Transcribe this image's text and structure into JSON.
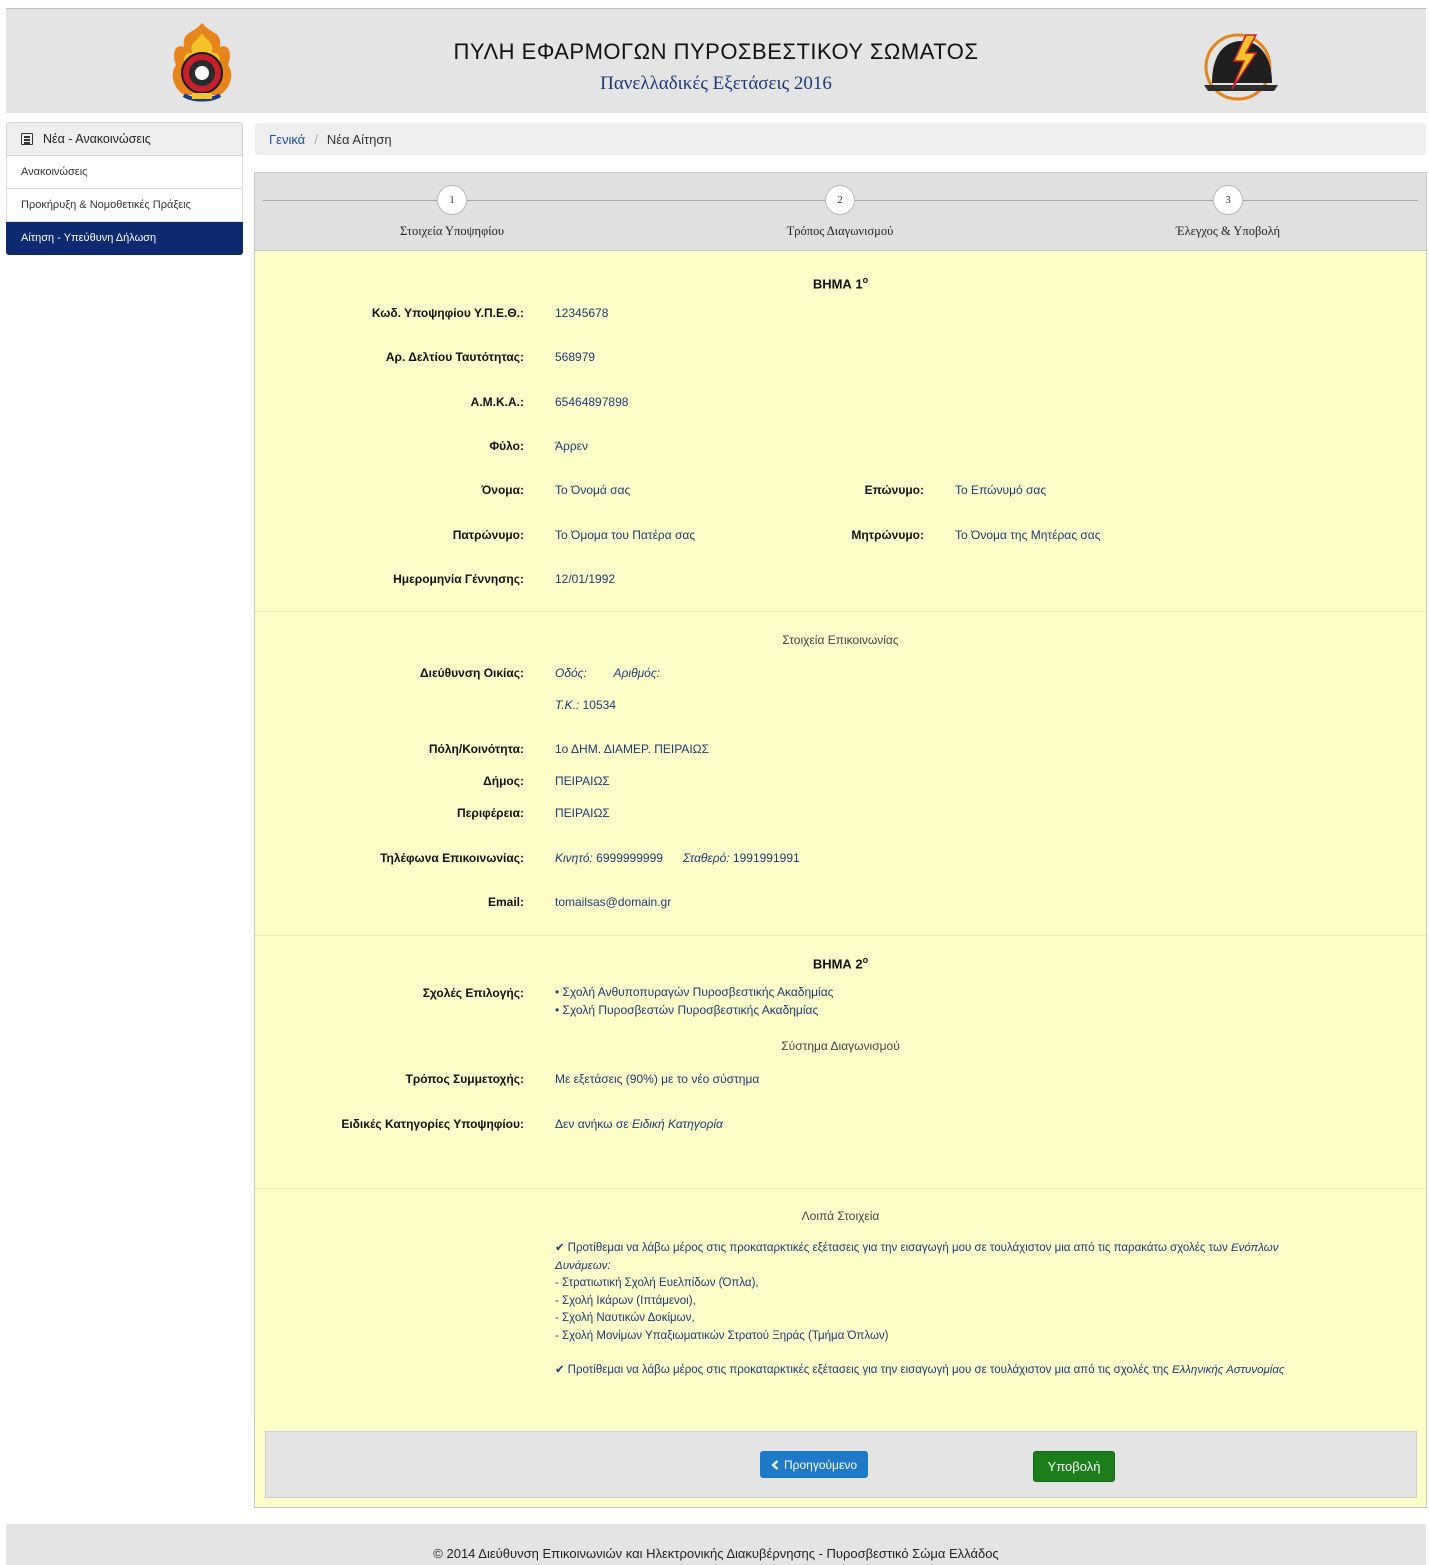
{
  "header": {
    "title": "ΠΥΛΗ ΕΦΑΡΜΟΓΩΝ ΠΥΡΟΣΒΕΣΤΙΚΟΥ ΣΩΜΑΤΟΣ",
    "subtitle": "Πανελλαδικές Εξετάσεις 2016",
    "logo_left": "fire-service-emblem",
    "logo_right": "firefighter-helmet-logo"
  },
  "sidebar": {
    "heading": "Νέα - Ανακοινώσεις",
    "heading_icon": "newspaper-icon",
    "items": [
      {
        "label": "Ανακοινώσεις"
      },
      {
        "label": "Προκήρυξη & Νομοθετικές Πράξεις"
      },
      {
        "label": "Αίτηση - Υπεύθυνη Δήλωση"
      }
    ]
  },
  "breadcrumb": {
    "home": "Γενικά",
    "separator": "/",
    "current": "Νέα Αίτηση"
  },
  "steps": [
    {
      "number": "1",
      "label": "Στοιχεία Υποψηφίου"
    },
    {
      "number": "2",
      "label": "Τρόπος Διαγωνισμού"
    },
    {
      "number": "3",
      "label": "Έλεγχος & Υποβολή"
    }
  ],
  "active_step_number": "3",
  "step1": {
    "title_main": "ΒΗΜΑ 1",
    "title_sup": "ο",
    "fields": {
      "code_label": "Κωδ. Υποψηφίου Υ.Π.Ε.Θ.:",
      "code_value": "12345678",
      "id_label": "Αρ. Δελτίου Ταυτότητας:",
      "id_value": "568979",
      "amka_label": "Α.Μ.Κ.Α.:",
      "amka_value": "65464897898",
      "gender_label": "Φύλο:",
      "gender_value": "Άρρεν",
      "name_label": "Όνομα:",
      "name_value": "Το Όνομά σας",
      "surname_label": "Επώνυμο:",
      "surname_value": "Το Επώνυμό σας",
      "father_label": "Πατρώνυμο:",
      "father_value": "Το Όμομα του Πατέρα σας",
      "mother_label": "Μητρώνυμο:",
      "mother_value": "Το Όνομα της Μητέρας σας",
      "dob_label": "Ημερομηνία Γέννησης:",
      "dob_value": "12/01/1992"
    }
  },
  "contact": {
    "title": "Στοιχεία Επικοινωνίας",
    "address_label": "Διεύθυνση Οικίας:",
    "street_label": "Οδός:",
    "number_label": "Αριθμός:",
    "postcode_label": "Τ.Κ.:",
    "postcode_value": "10534",
    "city_label": "Πόλη/Κοινότητα:",
    "city_value": "1ο ΔΗΜ. ΔΙΑΜΕΡ. ΠΕΙΡΑΙΩΣ",
    "municipality_label": "Δήμος:",
    "municipality_value": "ΠΕΙΡΑΙΩΣ",
    "region_label": "Περιφέρεια:",
    "region_value": "ΠΕΙΡΑΙΩΣ",
    "phones_label": "Τηλέφωνα Επικοινωνίας:",
    "mobile_label": "Κινητό:",
    "mobile_value": "6999999999",
    "landline_label": "Σταθερό:",
    "landline_value": "1991991991",
    "email_label": "Email:",
    "email_value": "tomailsas@domain.gr"
  },
  "step2": {
    "title_main": "ΒΗΜΑ 2",
    "title_sup": "ο",
    "schools_label": "Σχολές Επιλογής:",
    "schools": [
      "• Σχολή Ανθυποπυραγών Πυροσβεστικής Ακαδημίας",
      "• Σχολή Πυροσβεστών Πυροσβεστικής Ακαδημίας"
    ],
    "system_title": "Σύστημα Διαγωνισμού",
    "participation_label": "Τρόπος Συμμετοχής:",
    "participation_value": "Με εξετάσεις (90%) με το νέο σύστημα",
    "special_label": "Ειδικές Κατηγορίες Υποψηφίου:",
    "special_value_prefix": "Δεν ανήκω σε",
    "special_value_em": "Ειδική Κατηγορία"
  },
  "other": {
    "title": "Λοιπά Στοιχεία",
    "note1_text": "Προτίθεμαι να λάβω μέρος στις προκαταρκτικές εξέτασεις για την εισαγωγή μου σε τουλάχιστον μια από τις παρακάτω σχολές των",
    "note1_em": "Ενόπλων Δυνάμεων:",
    "note1_items": [
      "- Στρατιωτική Σχολή Ευελπίδων (Όπλα),",
      "- Σχολή Ικάρων (Ιπτάμενοι),",
      "- Σχολή Ναυτικών Δοκίμων,",
      "- Σχολή Μονίμων Υπαξιωματικών Στρατού Ξηράς (Τμήμα Όπλων)"
    ],
    "note2_text": "Προτίθεμαι να λάβω μέρος στις προκαταρκτικές εξέτασεις για την εισαγωγή μου σε τουλάχιστον μια από τις σχολές της",
    "note2_em": "Ελληνικής Αστυνομίας",
    "check_icon": "checkmark-icon"
  },
  "actions": {
    "prev_label": "Προηγούμενο",
    "submit_label": "Υποβολή"
  },
  "footer": {
    "text": "© 2014 Διεύθυνση Επικοινωνιών και Ηλεκτρονικής Διακυβέρνησης - Πυροσβεστικό Σώμα Ελλάδος"
  },
  "colors": {
    "accent": "#0b2a6f",
    "panel_bg": "#fdfdc9",
    "prev_button": "#1e7ac8",
    "submit_button": "#1b7e1b"
  }
}
